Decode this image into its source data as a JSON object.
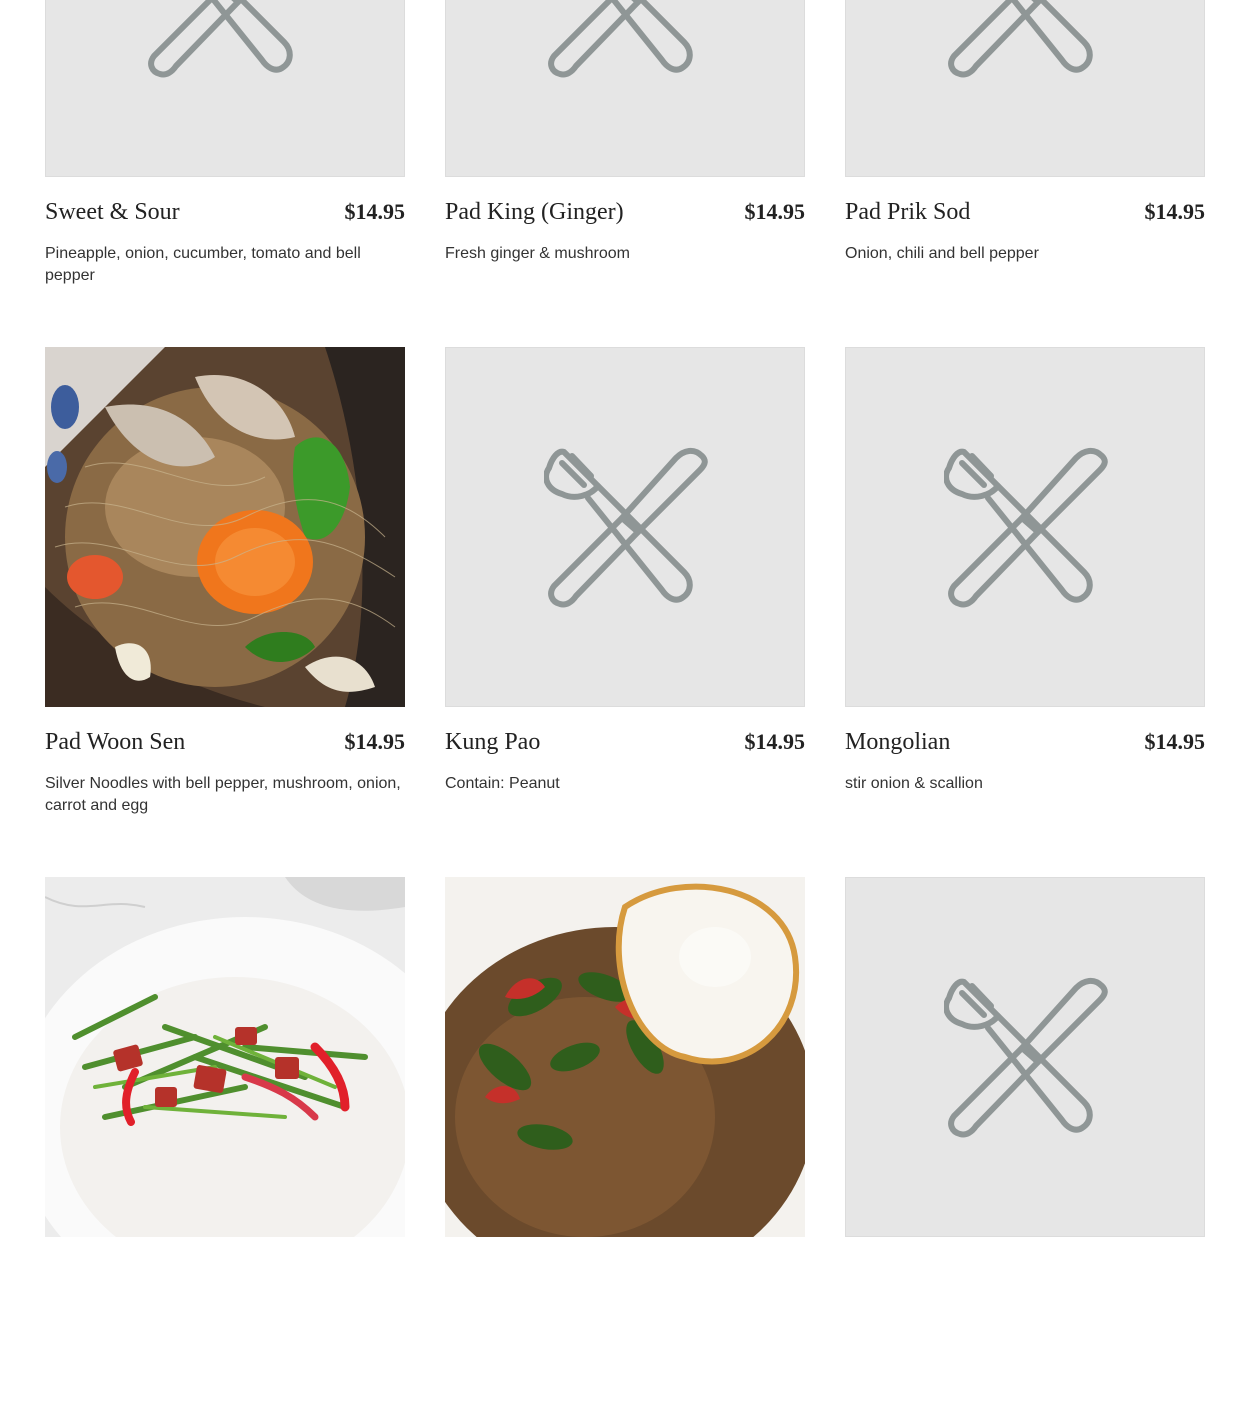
{
  "menu_items": [
    {
      "name": "Sweet & Sour",
      "price": "$14.95",
      "description": "Pineapple, onion, cucumber, tomato and bell pepper",
      "image": "fork-knife-placeholder-icon"
    },
    {
      "name": "Pad King (Ginger)",
      "price": "$14.95",
      "description": "Fresh ginger & mushroom",
      "image": "fork-knife-placeholder-icon"
    },
    {
      "name": "Pad Prik Sod",
      "price": "$14.95",
      "description": "Onion, chili and bell pepper",
      "image": "fork-knife-placeholder-icon"
    },
    {
      "name": "Pad Woon Sen",
      "price": "$14.95",
      "description": "Silver Noodles with bell pepper, mushroom, onion, carrot and egg",
      "image": "noodle-dish-photo"
    },
    {
      "name": "Kung Pao",
      "price": "$14.95",
      "description": "Contain: Peanut",
      "image": "fork-knife-placeholder-icon"
    },
    {
      "name": "Mongolian",
      "price": "$14.95",
      "description": "stir onion & scallion",
      "image": "fork-knife-placeholder-icon"
    },
    {
      "image": "green-bean-dish-photo"
    },
    {
      "image": "basil-fried-egg-dish-photo"
    },
    {
      "image": "fork-knife-placeholder-icon"
    }
  ],
  "colors": {
    "placeholder_bg": "#e6e6e6",
    "placeholder_icon": "#8f9696",
    "text": "#222222"
  }
}
